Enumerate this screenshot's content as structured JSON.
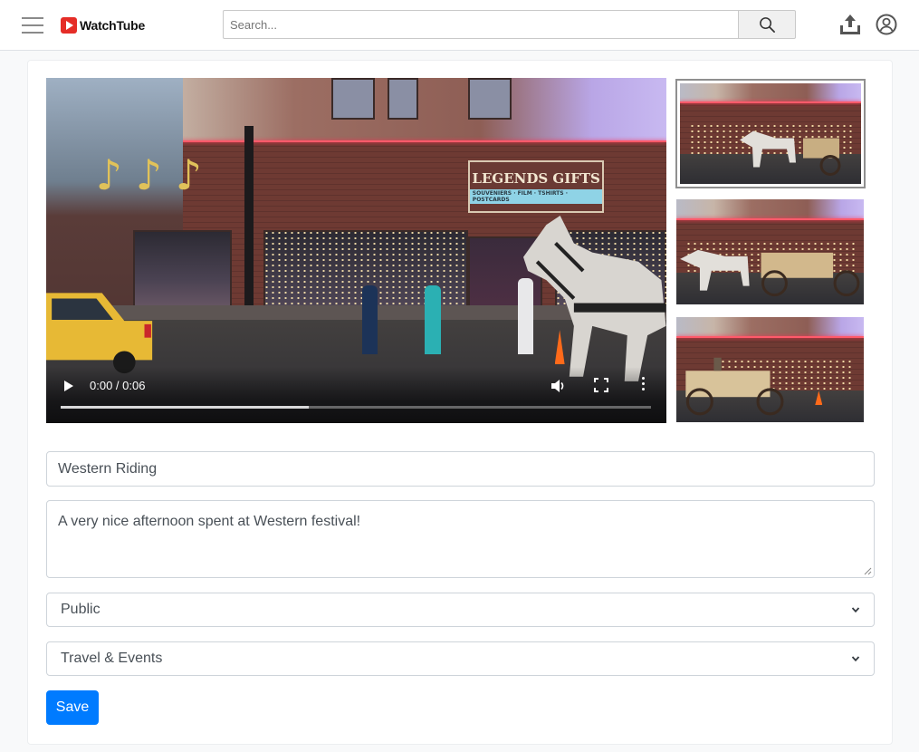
{
  "app": {
    "name": "WatchTube",
    "brand_color": "#e52d27"
  },
  "search": {
    "placeholder": "Search..."
  },
  "header": {
    "icons": [
      "menu-icon",
      "search-icon",
      "upload-icon",
      "account-icon"
    ]
  },
  "video": {
    "current_time": "0:00",
    "duration": "0:06",
    "time_display": "0:00 / 0:06",
    "buffered_fraction": 0.42,
    "sign_text": "LEGENDS GIFTS",
    "sign_subtext": "SOUVENIERS · FILM · TSHIRTS · POSTCARDS"
  },
  "thumbnails": {
    "count": 3,
    "selected_index": 0
  },
  "form": {
    "title_value": "Western Riding",
    "description_value": "A very nice afternoon spent at Western festival!",
    "visibility_value": "Public",
    "category_value": "Travel & Events",
    "save_label": "Save"
  },
  "colors": {
    "primary": "#007bff",
    "border": "#ced4da",
    "page_bg": "#f8f9fa"
  }
}
